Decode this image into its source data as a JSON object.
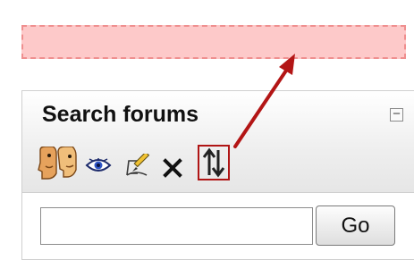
{
  "block": {
    "title": "Search forums",
    "collapse_label": "−",
    "go_label": "Go",
    "search_value": "",
    "icons": [
      "assign-roles-icon",
      "show-hide-eye-icon",
      "edit-configure-icon",
      "delete-x-icon",
      "move-icon"
    ]
  },
  "colors": {
    "drop_zone_fill": "#fdc9c9",
    "drop_zone_border": "#ef8f8f",
    "highlight": "#b01515"
  }
}
